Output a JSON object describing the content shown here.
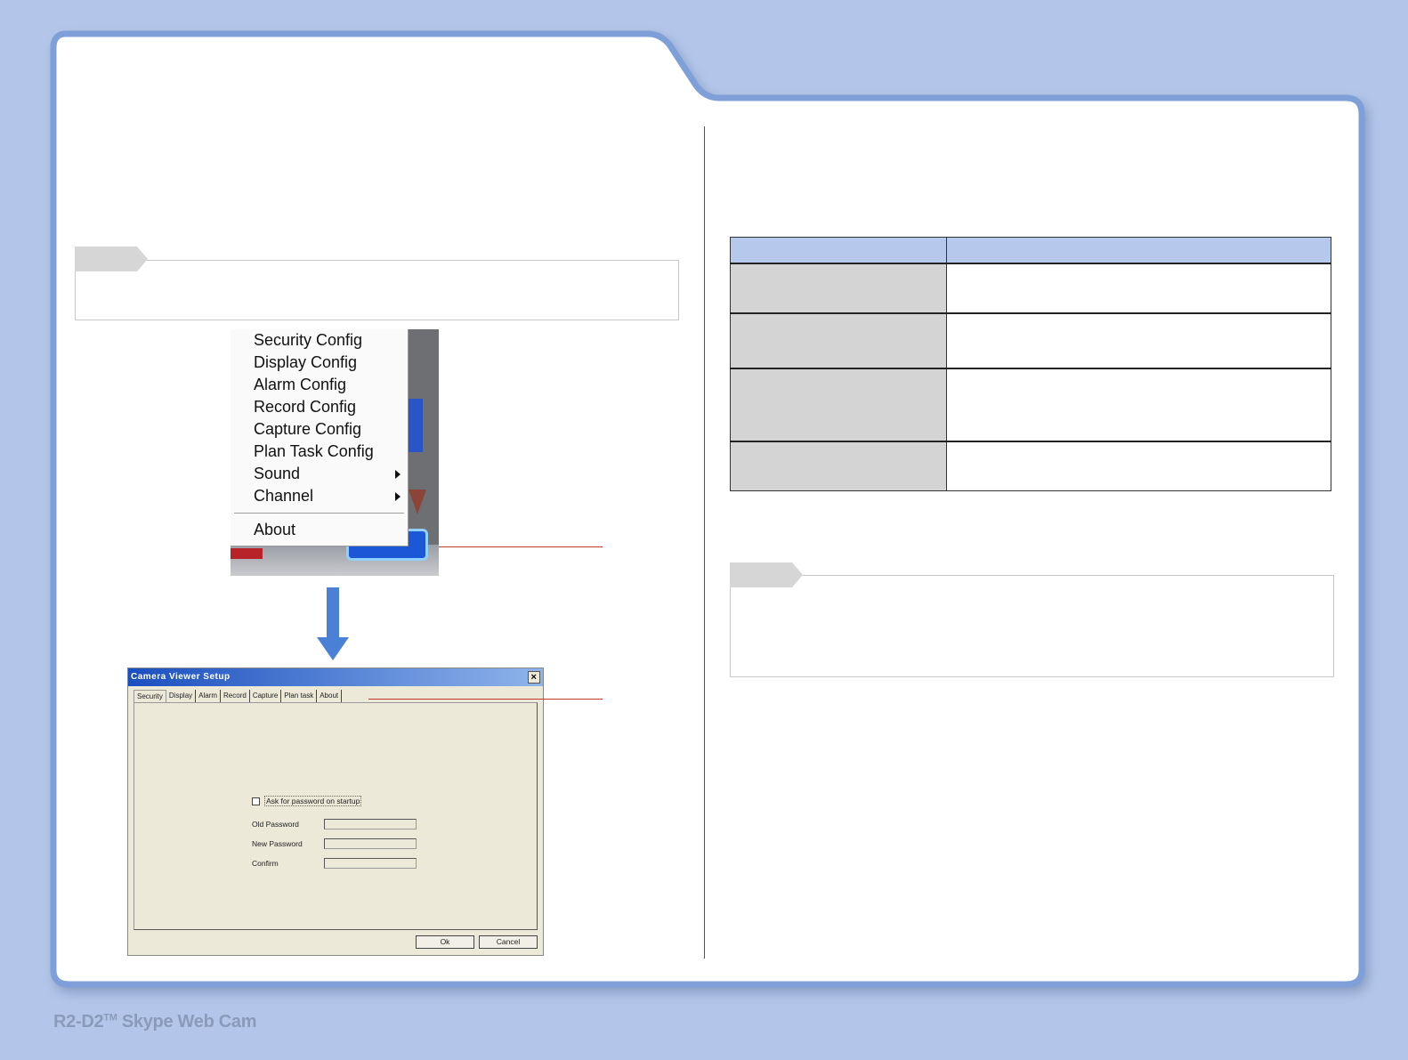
{
  "context_menu": {
    "items": [
      {
        "label": "Security Config",
        "submenu": false
      },
      {
        "label": "Display Config",
        "submenu": false
      },
      {
        "label": "Alarm Config",
        "submenu": false
      },
      {
        "label": "Record Config",
        "submenu": false
      },
      {
        "label": "Capture Config",
        "submenu": false
      },
      {
        "label": "Plan Task Config",
        "submenu": false
      },
      {
        "label": "Sound",
        "submenu": true
      },
      {
        "label": "Channel",
        "submenu": true
      }
    ],
    "about_label": "About"
  },
  "dialog": {
    "title": "Camera Viewer Setup",
    "close_glyph": "×",
    "tabs": [
      "Security",
      "Display",
      "Alarm",
      "Record",
      "Capture",
      "Plan task",
      "About"
    ],
    "active_tab": "Security",
    "checkbox_label": "Ask for password on startup",
    "fields": [
      "Old Password",
      "New Password",
      "Confirm"
    ],
    "ok_label": "Ok",
    "cancel_label": "Cancel"
  },
  "table": {
    "rows": 4
  },
  "footer": {
    "brand": "R2-D2",
    "tm": "TM",
    "product": " Skype Web Cam"
  },
  "colors": {
    "page_bg": "#b3c6ea",
    "panel_border": "#7f9fd8",
    "table_header": "#b6c9ec",
    "table_key": "#d4d4d4",
    "arrow": "#4a80d6",
    "callout": "#c0392b"
  }
}
